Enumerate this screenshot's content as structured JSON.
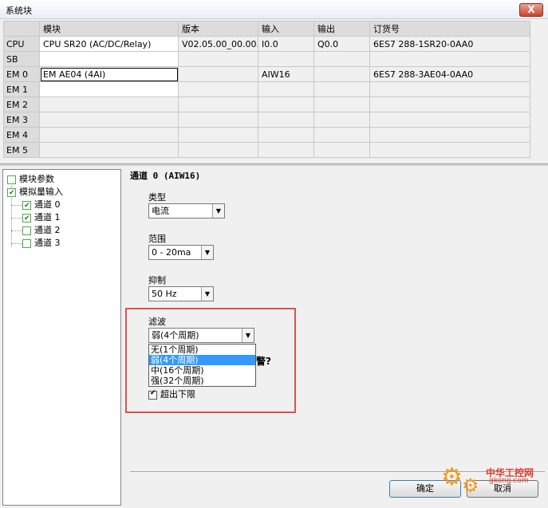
{
  "window": {
    "title": "系统块",
    "close_label": "X"
  },
  "grid": {
    "columns": [
      "",
      "模块",
      "版本",
      "输入",
      "输出",
      "订货号"
    ],
    "rows": [
      {
        "slot": "CPU",
        "module": "CPU SR20 (AC/DC/Relay)",
        "version": "V02.05.00_00.00...",
        "input": "I0.0",
        "output": "Q0.0",
        "order": "6ES7 288-1SR20-0AA0"
      },
      {
        "slot": "SB",
        "module": "",
        "version": "",
        "input": "",
        "output": "",
        "order": ""
      },
      {
        "slot": "EM 0",
        "module": "EM AE04 (4AI)",
        "version": "",
        "input": "AIW16",
        "output": "",
        "order": "6ES7 288-3AE04-0AA0"
      },
      {
        "slot": "EM 1",
        "module": "",
        "version": "",
        "input": "",
        "output": "",
        "order": ""
      },
      {
        "slot": "EM 2",
        "module": "",
        "version": "",
        "input": "",
        "output": "",
        "order": ""
      },
      {
        "slot": "EM 3",
        "module": "",
        "version": "",
        "input": "",
        "output": "",
        "order": ""
      },
      {
        "slot": "EM 4",
        "module": "",
        "version": "",
        "input": "",
        "output": "",
        "order": ""
      },
      {
        "slot": "EM 5",
        "module": "",
        "version": "",
        "input": "",
        "output": "",
        "order": ""
      }
    ]
  },
  "tree": {
    "items": [
      {
        "label": "模块参数",
        "checked": false
      },
      {
        "label": "模拟量输入",
        "checked": true
      },
      {
        "label": "通道 0",
        "checked": true
      },
      {
        "label": "通道 1",
        "checked": true
      },
      {
        "label": "通道 2",
        "checked": false
      },
      {
        "label": "通道 3",
        "checked": false
      }
    ]
  },
  "panel": {
    "heading": "通道 0 (AIW16)",
    "type_label": "类型",
    "type_value": "电流",
    "range_label": "范围",
    "range_value": "0 - 20ma",
    "rejection_label": "抑制",
    "rejection_value": "50 Hz",
    "filter_label": "滤波",
    "filter_value": "弱(4个周期)",
    "filter_options": [
      "无(1个周期)",
      "弱(4个周期)",
      "中(16个周期)",
      "强(32个周期)"
    ],
    "filter_selected_index": 1,
    "alarm_fragment": "警?",
    "underflow_label": "超出下限",
    "underflow_checked": true
  },
  "buttons": {
    "ok": "确定",
    "cancel": "取消"
  },
  "watermark": {
    "line1": "中华工控网",
    "line2": "gkong.com"
  },
  "colors": {
    "highlight": "#3399ff",
    "annotation_box": "#d9534f"
  }
}
